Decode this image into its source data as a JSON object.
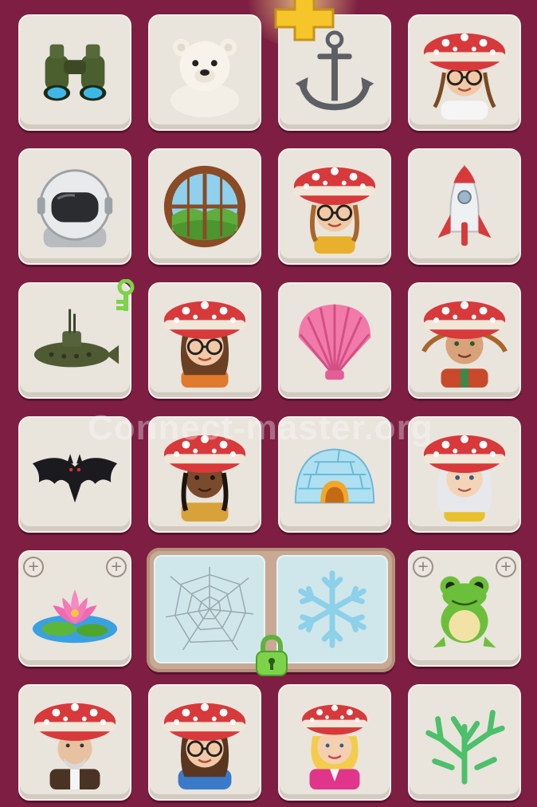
{
  "board": {
    "tiles": [
      {
        "icon": "binoculars-icon"
      },
      {
        "icon": "polar-bear-icon"
      },
      {
        "icon": "anchor-icon"
      },
      {
        "icon": "mushroom-girl-glasses-braids-icon"
      },
      {
        "icon": "astronaut-helmet-icon"
      },
      {
        "icon": "round-window-icon"
      },
      {
        "icon": "mushroom-girl-curly-glasses-icon"
      },
      {
        "icon": "rocket-icon"
      },
      {
        "icon": "submarine-icon"
      },
      {
        "icon": "mushroom-woman-glasses-icon"
      },
      {
        "icon": "seashell-icon"
      },
      {
        "icon": "mushroom-boy-braids-icon"
      },
      {
        "icon": "bat-icon"
      },
      {
        "icon": "mushroom-girl-dark-braids-icon"
      },
      {
        "icon": "igloo-icon"
      },
      {
        "icon": "mushroom-woman-white-hair-icon"
      },
      {
        "icon": "water-lily-icon"
      },
      {
        "icon": "frog-icon"
      },
      {
        "icon": "mushroom-old-man-icon"
      },
      {
        "icon": "mushroom-girl-blue-hoodie-icon"
      },
      {
        "icon": "mushroom-blonde-woman-icon"
      },
      {
        "icon": "coral-icon"
      }
    ],
    "locked_pair": {
      "left_icon": "spider-web-icon",
      "right_icon": "snowflake-icon",
      "lock_icon": "green-lock-icon"
    },
    "top_powerup": "gold-plus-icon",
    "key_badge": "green-key-icon"
  },
  "watermark": "Connect-master.org",
  "colors": {
    "background": "#7d1e42",
    "tile": "#e9e4dc",
    "mushroom_cap": "#d8393b",
    "lock_green": "#7cd34a"
  }
}
